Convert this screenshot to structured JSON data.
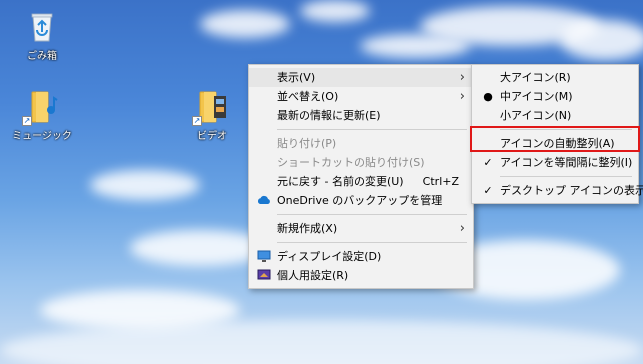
{
  "desktop": {
    "icons": [
      {
        "label": "ごみ箱",
        "icon": "recycle-bin-icon"
      },
      {
        "label": "ミュージック",
        "icon": "music-folder-icon"
      },
      {
        "label": "ビデオ",
        "icon": "video-folder-icon"
      }
    ]
  },
  "context_menu": {
    "items": [
      {
        "label": "表示(V)",
        "has_submenu": true,
        "state": "hover"
      },
      {
        "label": "並べ替え(O)",
        "has_submenu": true
      },
      {
        "label": "最新の情報に更新(E)"
      },
      {
        "separator": true
      },
      {
        "label": "貼り付け(P)",
        "disabled": true
      },
      {
        "label": "ショートカットの貼り付け(S)",
        "disabled": true
      },
      {
        "label": "元に戻す - 名前の変更(U)",
        "shortcut": "Ctrl+Z"
      },
      {
        "label": "OneDrive のバックアップを管理",
        "icon": "onedrive-icon"
      },
      {
        "separator": true
      },
      {
        "label": "新規作成(X)",
        "has_submenu": true
      },
      {
        "separator": true
      },
      {
        "label": "ディスプレイ設定(D)",
        "icon": "display-settings-icon"
      },
      {
        "label": "個人用設定(R)",
        "icon": "personalize-icon"
      }
    ]
  },
  "view_submenu": {
    "items": [
      {
        "label": "大アイコン(R)"
      },
      {
        "label": "中アイコン(M)",
        "mark": "●"
      },
      {
        "label": "小アイコン(N)"
      },
      {
        "separator": true
      },
      {
        "label": "アイコンの自動整列(A)",
        "highlighted": true
      },
      {
        "label": "アイコンを等間隔に整列(I)",
        "mark": "✓"
      },
      {
        "separator": true
      },
      {
        "label": "デスクトップ アイコンの表示(D)",
        "mark": "✓"
      }
    ]
  },
  "colors": {
    "highlight_border": "#e01818",
    "menu_background": "#f2f2f2"
  }
}
